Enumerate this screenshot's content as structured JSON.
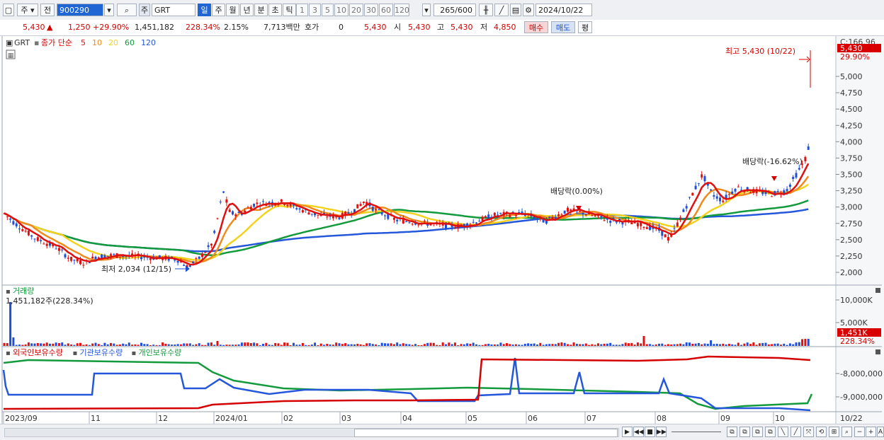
{
  "toolbar": {
    "market": "주",
    "prev": "전",
    "code": "900290",
    "name_badge": "주",
    "name": "GRT",
    "periods": [
      "일",
      "주",
      "월",
      "년",
      "분",
      "초",
      "틱"
    ],
    "active_period": "일",
    "intervals": [
      "1",
      "3",
      "5",
      "10",
      "20",
      "30",
      "60",
      "120"
    ],
    "count": "265",
    "count_total": "/600",
    "date": "2024/10/22"
  },
  "quote": {
    "price": "5,430",
    "change": "1,250",
    "change_pct": "+29.90%",
    "volume": "1,451,182",
    "volume_ratio": "228.34%",
    "turnover": "2.15%",
    "amount": "7,713백만",
    "hoga_label": "호가",
    "hoga_value": "0",
    "hoga_price": "5,430",
    "open_label": "시",
    "open": "5,430",
    "high_label": "고",
    "high": "5,430",
    "low_label": "저",
    "low": "4,850",
    "buy": "매수",
    "sell": "매도",
    "eval": "평"
  },
  "price_panel": {
    "symbol": "GRT",
    "ma_title": "종가 단순",
    "ma_periods": [
      "5",
      "10",
      "20",
      "60",
      "120"
    ],
    "ma_colors": [
      "#e01010",
      "#f08a1c",
      "#f2d21c",
      "#129a3c",
      "#2457d9"
    ],
    "corner_value": "C:166.96",
    "last_price": "5,430",
    "last_pct": "29.90%",
    "y_ticks": [
      "5,000",
      "4,750",
      "4,500",
      "4,250",
      "4,000",
      "3,750",
      "3,500",
      "3,250",
      "3,000",
      "2,750",
      "2,500",
      "2,250",
      "2,000"
    ],
    "high_note": "최고 5,430 (10/22)",
    "low_note": "최저 2,034 (12/15)",
    "div_note_1": "배당락(0.00%)",
    "div_note_2": "배당락(-16.62%)"
  },
  "volume_panel": {
    "title": "거래량",
    "info": "1,451,182주(228.34%)",
    "y_ticks": [
      "10,000K",
      "5,000K"
    ],
    "last": "1,451K",
    "last_pct": "228.34%"
  },
  "holding_panel": {
    "legend": [
      "외국인보유수량",
      "기관보유수량",
      "개인보유수량"
    ],
    "legend_colors": [
      "#d40000",
      "#2457d9",
      "#129a3c"
    ],
    "y_ticks": [
      "-8,000,000",
      "-9,000,000"
    ]
  },
  "x_axis": {
    "labels": [
      "2023/09",
      "11",
      "12",
      "2024/01",
      "02",
      "03",
      "04",
      "05",
      "06",
      "07",
      "08",
      "09",
      "10"
    ],
    "right_label": "10/22"
  }
}
